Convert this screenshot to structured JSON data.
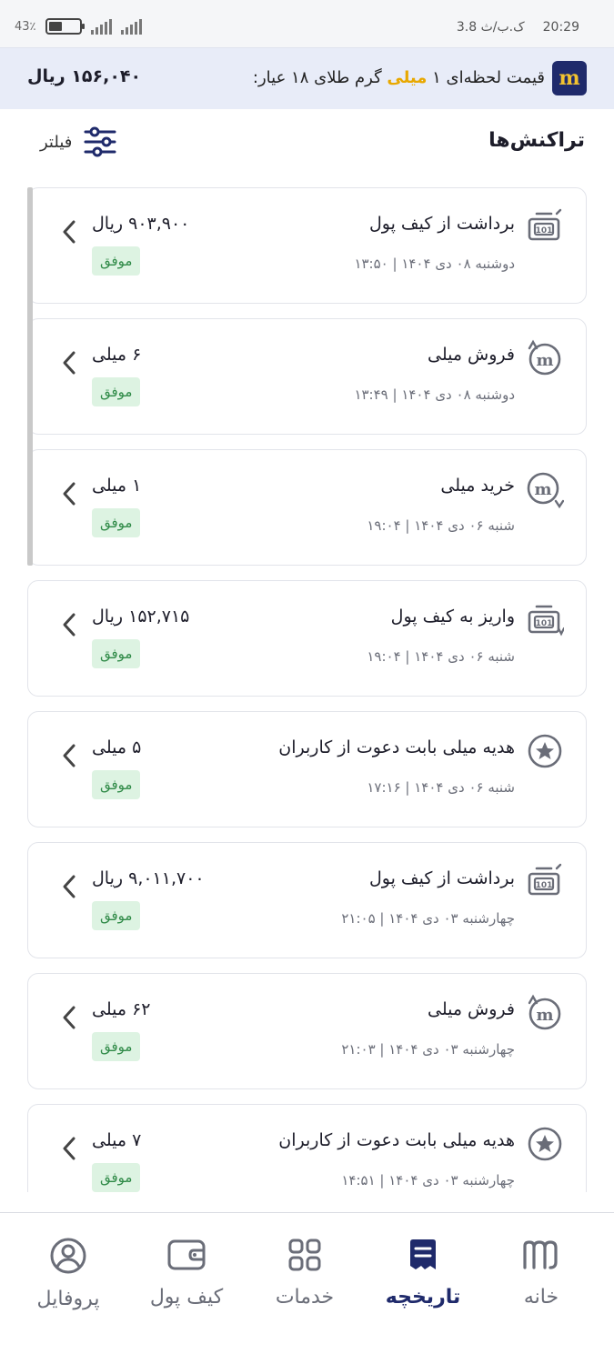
{
  "status_bar": {
    "battery_text": "43٪",
    "battery_level": 0.43,
    "time": "20:29",
    "data_rate": "3.8 ک.ب/ث"
  },
  "price_bar": {
    "brand_icon": "milli-logo-icon",
    "label_before": "قیمت لحظه‌ای ۱ ",
    "label_highlight": "میلی",
    "label_after": " گرم طلای ۱۸ عیار:",
    "value": "۱۵۶,۰۴۰ ریال",
    "highlight_color": "#e8a800"
  },
  "section": {
    "title": "تراکنش‌ها",
    "filter_label": "فیلتر",
    "filter_icon": "filter-sliders-icon"
  },
  "transactions": [
    {
      "icon": "wallet-withdraw-icon",
      "title": "برداشت از کیف پول",
      "date": "دوشنبه ۰۸ دی ۱۴۰۴ | ۱۳:۵۰",
      "amount": "۹۰۳,۹۰۰ ریال",
      "status": "موفق"
    },
    {
      "icon": "milli-sell-icon",
      "title": "فروش میلی",
      "date": "دوشنبه ۰۸ دی ۱۴۰۴ | ۱۳:۴۹",
      "amount": "۶ میلی",
      "status": "موفق"
    },
    {
      "icon": "milli-buy-icon",
      "title": "خرید میلی",
      "date": "شنبه ۰۶ دی ۱۴۰۴ | ۱۹:۰۴",
      "amount": "۱ میلی",
      "status": "موفق"
    },
    {
      "icon": "wallet-deposit-icon",
      "title": "واریز به کیف پول",
      "date": "شنبه ۰۶ دی ۱۴۰۴ | ۱۹:۰۴",
      "amount": "۱۵۲,۷۱۵ ریال",
      "status": "موفق"
    },
    {
      "icon": "star-gift-icon",
      "title": "هدیه میلی بابت دعوت از کاربران",
      "date": "شنبه ۰۶ دی ۱۴۰۴ | ۱۷:۱۶",
      "amount": "۵ میلی",
      "status": "موفق"
    },
    {
      "icon": "wallet-withdraw-icon",
      "title": "برداشت از کیف پول",
      "date": "چهارشنبه ۰۳ دی ۱۴۰۴ | ۲۱:۰۵",
      "amount": "۹,۰۱۱,۷۰۰ ریال",
      "status": "موفق"
    },
    {
      "icon": "milli-sell-icon",
      "title": "فروش میلی",
      "date": "چهارشنبه ۰۳ دی ۱۴۰۴ | ۲۱:۰۳",
      "amount": "۶۲ میلی",
      "status": "موفق"
    },
    {
      "icon": "star-gift-icon",
      "title": "هدیه میلی بابت دعوت از کاربران",
      "date": "چهارشنبه ۰۳ دی ۱۴۰۴ | ۱۴:۵۱",
      "amount": "۷ میلی",
      "status": "موفق"
    }
  ],
  "bottom_nav": {
    "items": [
      {
        "label": "خانه",
        "icon": "home-milli-icon"
      },
      {
        "label": "تاریخچه",
        "icon": "history-receipt-icon",
        "active": true
      },
      {
        "label": "خدمات",
        "icon": "services-grid-icon"
      },
      {
        "label": "کیف پول",
        "icon": "wallet-icon"
      },
      {
        "label": "پروفایل",
        "icon": "profile-user-icon"
      }
    ],
    "active_color": "#1f2a6b"
  }
}
